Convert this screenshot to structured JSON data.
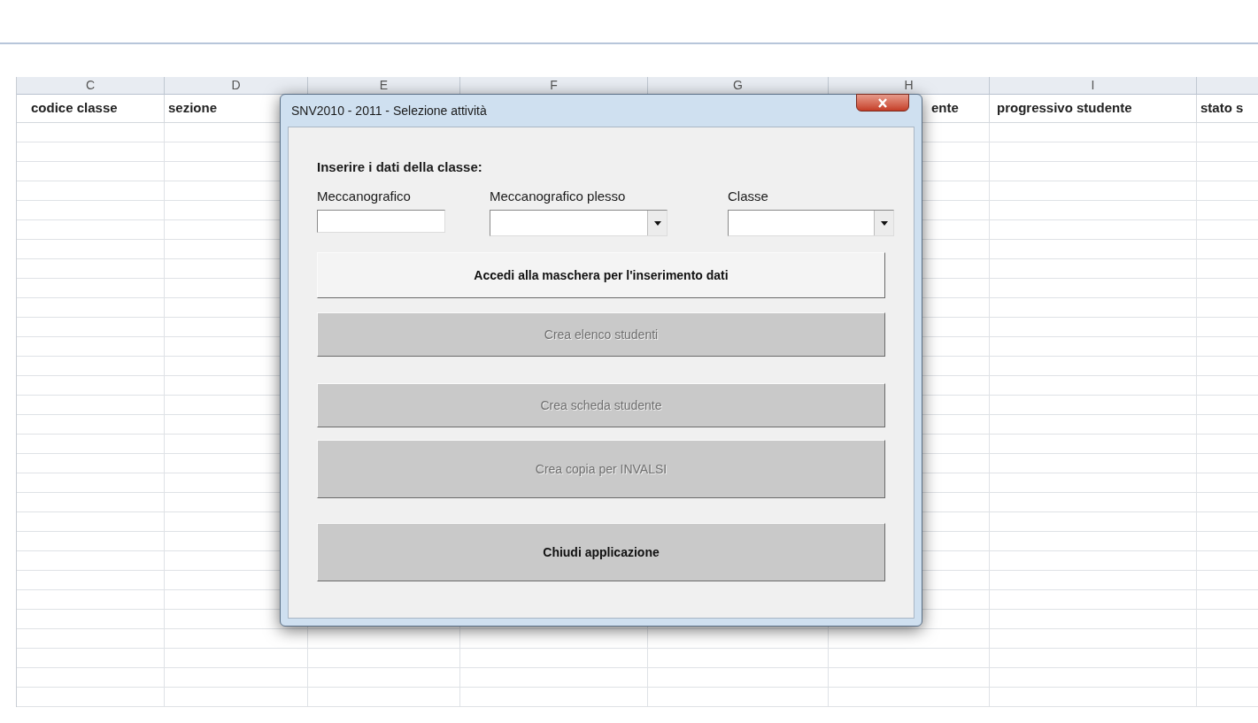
{
  "sheet": {
    "columns": [
      {
        "letter": "C",
        "header": "codice classe"
      },
      {
        "letter": "D",
        "header": "sezione"
      },
      {
        "letter": "E"
      },
      {
        "letter": "F"
      },
      {
        "letter": "G"
      },
      {
        "letter": "H",
        "header": "ente"
      },
      {
        "letter": "I",
        "header": "progressivo studente"
      },
      {
        "header": "stato s"
      }
    ]
  },
  "dialog": {
    "title": "SNV2010 - 2011 - Selezione attività",
    "intro": "Inserire i dati della classe:",
    "fields": [
      {
        "label": "Meccanografico",
        "kind": "text"
      },
      {
        "label": "Meccanografico plesso",
        "kind": "combo"
      },
      {
        "label": "Classe",
        "kind": "combo"
      }
    ],
    "buttons": [
      {
        "label": "Accedi alla maschera per l'inserimento dati",
        "kind": "light",
        "disabled": false
      },
      {
        "label": "Crea elenco studenti",
        "kind": "gray",
        "disabled": true
      },
      {
        "label": "Crea scheda studente",
        "kind": "gray",
        "disabled": true
      },
      {
        "label": "Crea copia per INVALSI",
        "kind": "gray",
        "disabled": true
      },
      {
        "label": "Chiudi applicazione",
        "kind": "gray",
        "disabled": false
      }
    ]
  }
}
